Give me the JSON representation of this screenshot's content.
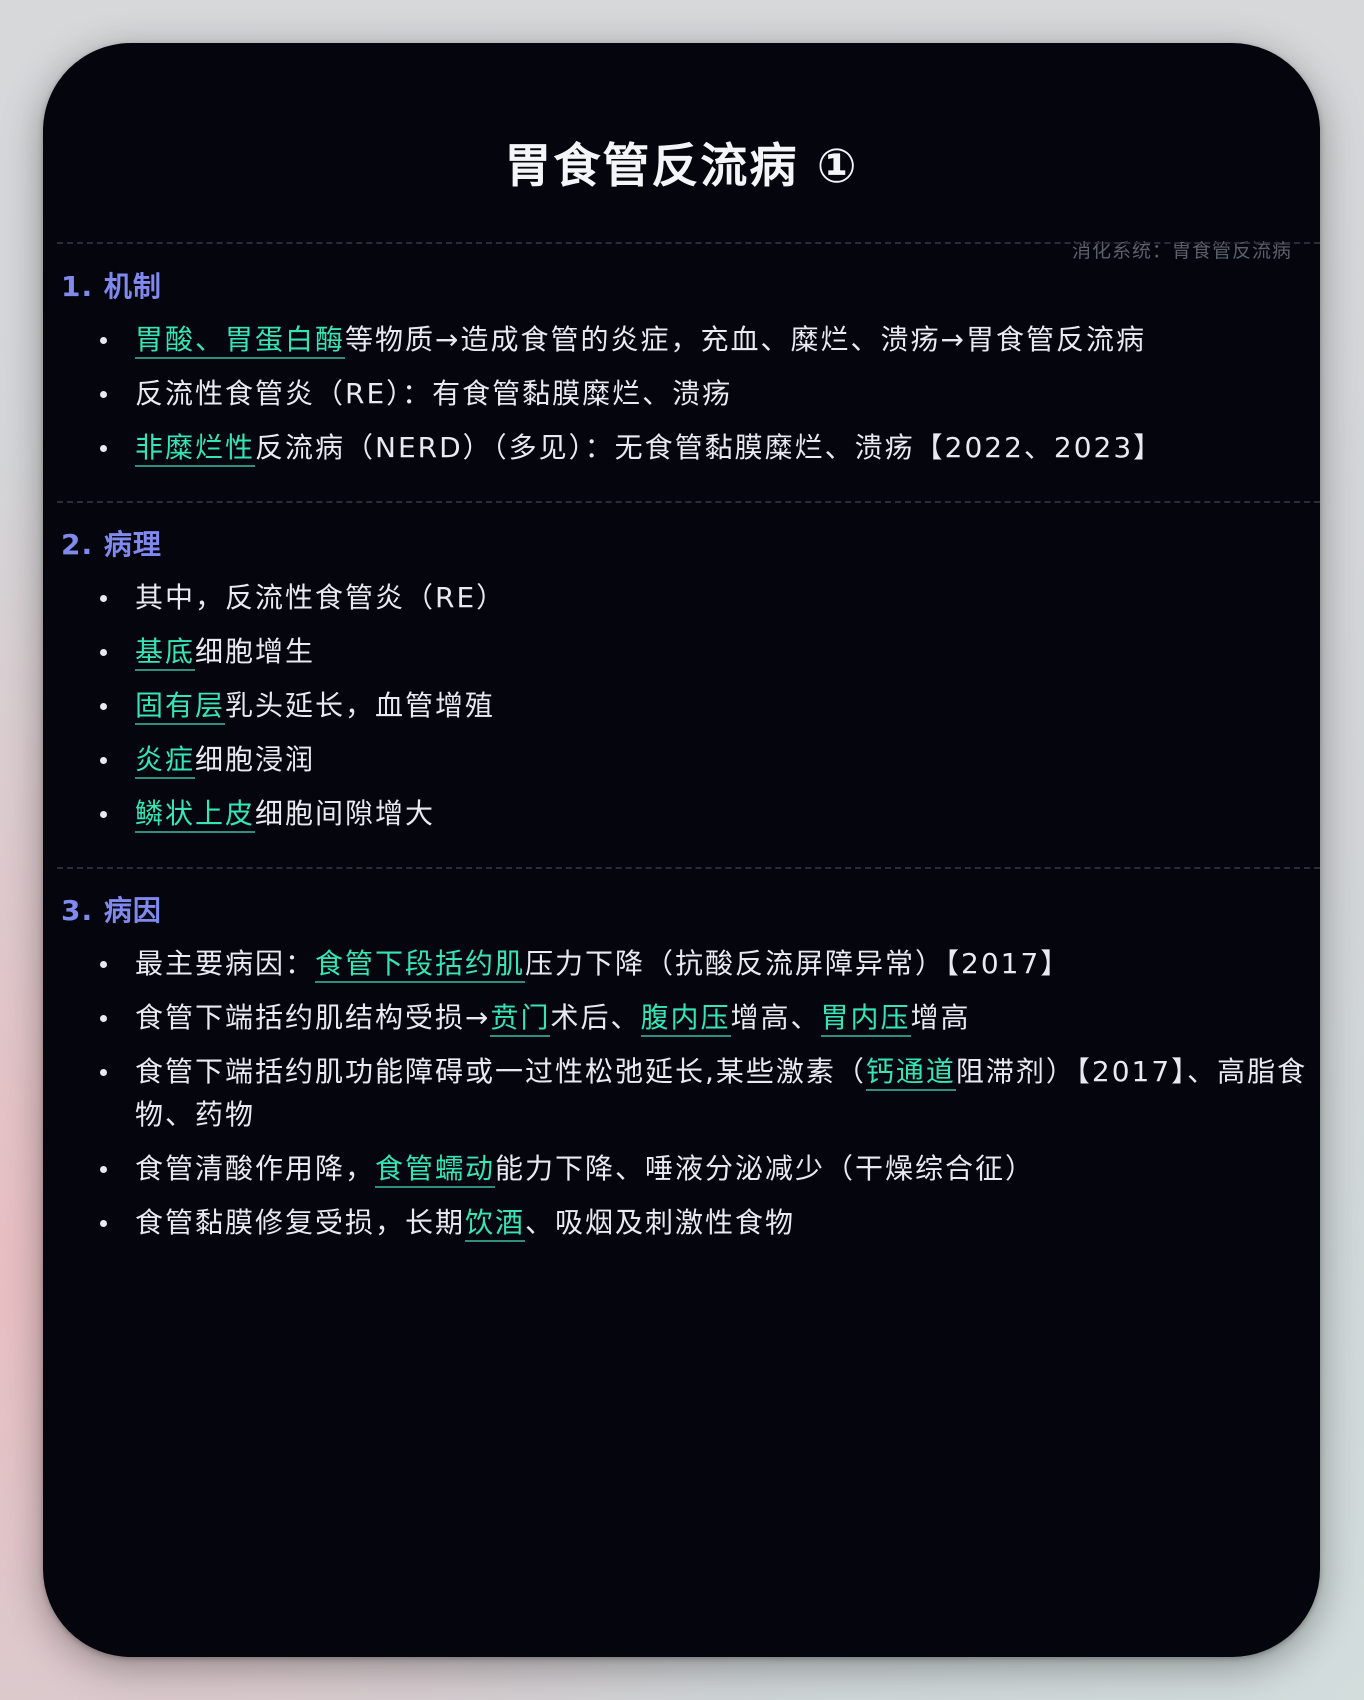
{
  "title": "胃食管反流病 ①",
  "subtitle": "消化系统：胃食管反流病",
  "sections": [
    {
      "heading": "1. 机制",
      "items": [
        [
          {
            "t": "胃酸、胃蛋白酶",
            "hl": true
          },
          {
            "t": "等物质→造成食管的炎症，充血、糜烂、溃疡→胃食管反流病"
          }
        ],
        [
          {
            "t": "反流性食管炎（RE）：有食管黏膜糜烂、溃疡"
          }
        ],
        [
          {
            "t": "非糜烂性",
            "hl": true
          },
          {
            "t": "反流病（NERD）（多见）：无食管黏膜糜烂、溃疡【2022、2023】"
          }
        ]
      ]
    },
    {
      "heading": "2. 病理",
      "items": [
        [
          {
            "t": "其中，反流性食管炎（RE）"
          }
        ],
        [
          {
            "t": "基底",
            "hl": true
          },
          {
            "t": "细胞增生"
          }
        ],
        [
          {
            "t": "固有层",
            "hl": true
          },
          {
            "t": "乳头延长，血管增殖"
          }
        ],
        [
          {
            "t": "炎症",
            "hl": true
          },
          {
            "t": "细胞浸润"
          }
        ],
        [
          {
            "t": "鳞状上皮",
            "hl": true
          },
          {
            "t": "细胞间隙增大"
          }
        ]
      ]
    },
    {
      "heading": "3. 病因",
      "items": [
        [
          {
            "t": "最主要病因："
          },
          {
            "t": "食管下段括约肌",
            "hl": true
          },
          {
            "t": "压力下降（抗酸反流屏障异常）【2017】"
          }
        ],
        [
          {
            "t": "食管下端括约肌结构受损→"
          },
          {
            "t": "贲门",
            "hl": true
          },
          {
            "t": "术后、"
          },
          {
            "t": "腹内压",
            "hl": true
          },
          {
            "t": "增高、"
          },
          {
            "t": "胃内压",
            "hl": true
          },
          {
            "t": "增高"
          }
        ],
        [
          {
            "t": "食管下端括约肌功能障碍或一过性松弛延长,某些激素（"
          },
          {
            "t": "钙通道",
            "hl": true
          },
          {
            "t": "阻滞剂）【2017】、高脂食物、药物"
          }
        ],
        [
          {
            "t": "食管清酸作用降，"
          },
          {
            "t": "食管蠕动",
            "hl": true
          },
          {
            "t": "能力下降、唾液分泌减少（干燥综合征）"
          }
        ],
        [
          {
            "t": "食管黏膜修复受损，长期"
          },
          {
            "t": "饮酒",
            "hl": true
          },
          {
            "t": "、吸烟及刺激性食物"
          }
        ]
      ]
    }
  ]
}
